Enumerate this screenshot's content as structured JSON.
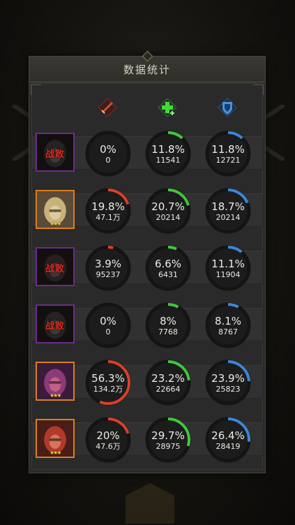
{
  "panel": {
    "title": "数据统计"
  },
  "columns": [
    {
      "icon": "sword-damage-icon",
      "color": "#d7412a"
    },
    {
      "icon": "green-cross-heal-icon",
      "color": "#3fc93a"
    },
    {
      "icon": "blue-shield-icon",
      "color": "#3f86d6"
    }
  ],
  "defeat_text": "战败",
  "rows": [
    {
      "hero": "hooded-dark-hero",
      "defeated": true,
      "frame": "purple",
      "stars": "",
      "stats": [
        {
          "pct": "0%",
          "val": "0",
          "fraction": 0.0
        },
        {
          "pct": "11.8%",
          "val": "11541",
          "fraction": 0.118
        },
        {
          "pct": "11.8%",
          "val": "12721",
          "fraction": 0.118
        }
      ]
    },
    {
      "hero": "blonde-armored-hero",
      "defeated": false,
      "frame": "orange",
      "stars": "★★★",
      "stats": [
        {
          "pct": "19.8%",
          "val": "47.1万",
          "fraction": 0.198
        },
        {
          "pct": "20.7%",
          "val": "20214",
          "fraction": 0.207
        },
        {
          "pct": "18.7%",
          "val": "20214",
          "fraction": 0.187
        }
      ]
    },
    {
      "hero": "masked-red-hero",
      "defeated": true,
      "frame": "purple",
      "stars": "",
      "stats": [
        {
          "pct": "3.9%",
          "val": "95237",
          "fraction": 0.039
        },
        {
          "pct": "6.6%",
          "val": "6431",
          "fraction": 0.066
        },
        {
          "pct": "11.1%",
          "val": "11904",
          "fraction": 0.111
        }
      ]
    },
    {
      "hero": "hooded-dark-hero",
      "defeated": true,
      "frame": "purple",
      "stars": "",
      "stats": [
        {
          "pct": "0%",
          "val": "0",
          "fraction": 0.0
        },
        {
          "pct": "8%",
          "val": "7768",
          "fraction": 0.08
        },
        {
          "pct": "8.1%",
          "val": "8767",
          "fraction": 0.081
        }
      ]
    },
    {
      "hero": "purple-robot-hero",
      "defeated": false,
      "frame": "orange",
      "stars": "★★★",
      "stats": [
        {
          "pct": "56.3%",
          "val": "134.2万",
          "fraction": 0.563
        },
        {
          "pct": "23.2%",
          "val": "22664",
          "fraction": 0.232
        },
        {
          "pct": "23.9%",
          "val": "25823",
          "fraction": 0.239
        }
      ]
    },
    {
      "hero": "red-haired-hero",
      "defeated": false,
      "frame": "orange",
      "stars": "★★★",
      "stats": [
        {
          "pct": "20%",
          "val": "47.6万",
          "fraction": 0.2
        },
        {
          "pct": "29.7%",
          "val": "28975",
          "fraction": 0.297
        },
        {
          "pct": "26.4%",
          "val": "28419",
          "fraction": 0.264
        }
      ]
    }
  ]
}
